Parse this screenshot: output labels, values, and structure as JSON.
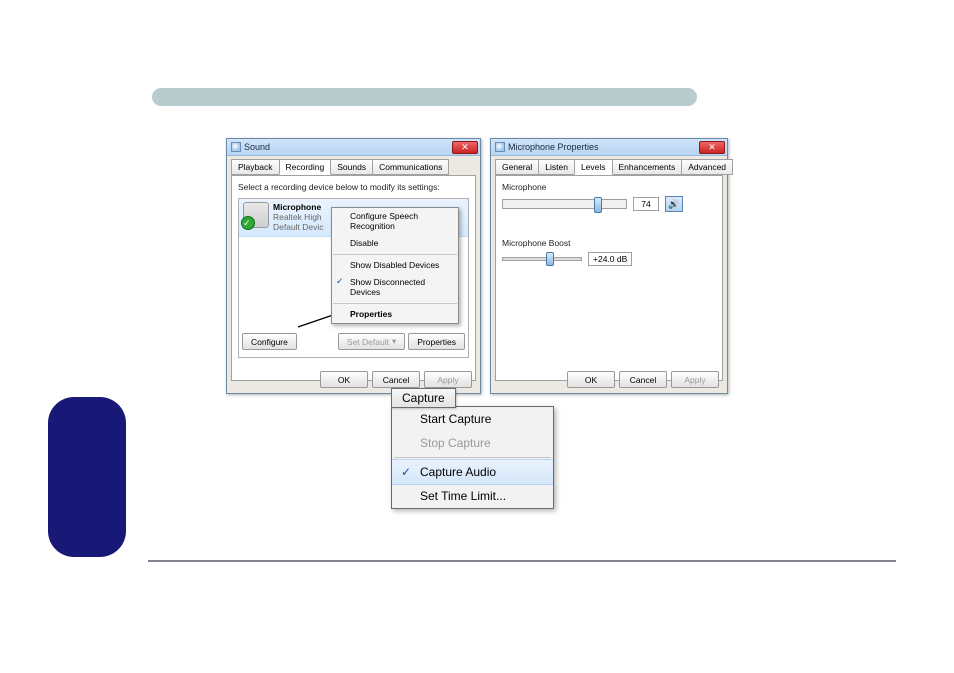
{
  "sound_dialog": {
    "title": "Sound",
    "tabs": [
      "Playback",
      "Recording",
      "Sounds",
      "Communications"
    ],
    "active_tab": 1,
    "instruction": "Select a recording device below to modify its settings:",
    "device": {
      "name": "Microphone",
      "line2": "Realtek High",
      "line3": "Default Devic"
    },
    "context_menu": {
      "items": [
        {
          "label": "Configure Speech Recognition",
          "type": "item"
        },
        {
          "label": "Disable",
          "type": "item"
        },
        {
          "type": "sep"
        },
        {
          "label": "Show Disabled Devices",
          "type": "item"
        },
        {
          "label": "Show Disconnected Devices",
          "type": "item",
          "checked": true
        },
        {
          "type": "sep"
        },
        {
          "label": "Properties",
          "type": "item",
          "bold": true
        }
      ]
    },
    "buttons": {
      "configure": "Configure",
      "set_default": "Set Default",
      "properties": "Properties",
      "ok": "OK",
      "cancel": "Cancel",
      "apply": "Apply"
    }
  },
  "mic_props": {
    "title": "Microphone Properties",
    "tabs": [
      "General",
      "Listen",
      "Levels",
      "Enhancements",
      "Advanced"
    ],
    "active_tab": 2,
    "mic_label": "Microphone",
    "mic_value": "74",
    "boost_label": "Microphone Boost",
    "boost_value": "+24.0 dB",
    "buttons": {
      "ok": "OK",
      "cancel": "Cancel",
      "apply": "Apply"
    }
  },
  "capture_menu": {
    "title": "Capture",
    "items": [
      {
        "label": "Start Capture",
        "type": "item"
      },
      {
        "label": "Stop Capture",
        "type": "item",
        "disabled": true
      },
      {
        "type": "sep"
      },
      {
        "label": "Capture Audio",
        "type": "item",
        "checked": true,
        "hover": true
      },
      {
        "label": "Set Time Limit...",
        "type": "item"
      }
    ]
  }
}
